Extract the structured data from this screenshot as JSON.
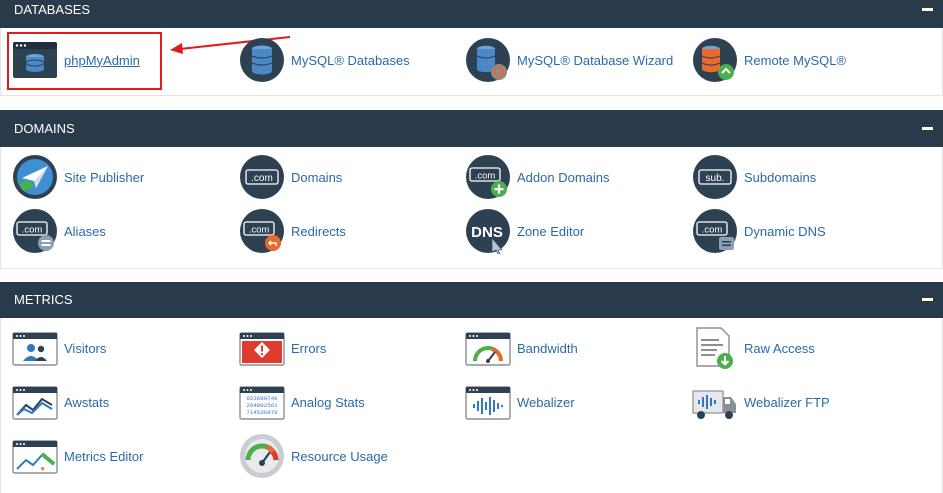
{
  "sections": {
    "databases": {
      "title": "DATABASES",
      "items": [
        {
          "label": "phpMyAdmin",
          "icon": "phpmyadmin-icon"
        },
        {
          "label": "MySQL® Databases",
          "icon": "mysql-databases-icon"
        },
        {
          "label": "MySQL® Database Wizard",
          "icon": "mysql-wizard-icon"
        },
        {
          "label": "Remote MySQL®",
          "icon": "remote-mysql-icon"
        }
      ]
    },
    "domains": {
      "title": "DOMAINS",
      "items": [
        {
          "label": "Site Publisher",
          "icon": "site-publisher-icon"
        },
        {
          "label": "Domains",
          "icon": "domains-icon",
          "glyph": ".com"
        },
        {
          "label": "Addon Domains",
          "icon": "addon-domains-icon",
          "glyph": ".com"
        },
        {
          "label": "Subdomains",
          "icon": "subdomains-icon",
          "glyph": "sub."
        },
        {
          "label": "Aliases",
          "icon": "aliases-icon",
          "glyph": ".com"
        },
        {
          "label": "Redirects",
          "icon": "redirects-icon",
          "glyph": ".com"
        },
        {
          "label": "Zone Editor",
          "icon": "zone-editor-icon",
          "glyph": "DNS"
        },
        {
          "label": "Dynamic DNS",
          "icon": "dynamic-dns-icon",
          "glyph": ".com"
        }
      ]
    },
    "metrics": {
      "title": "METRICS",
      "items": [
        {
          "label": "Visitors",
          "icon": "visitors-icon"
        },
        {
          "label": "Errors",
          "icon": "errors-icon"
        },
        {
          "label": "Bandwidth",
          "icon": "bandwidth-icon"
        },
        {
          "label": "Raw Access",
          "icon": "raw-access-icon"
        },
        {
          "label": "Awstats",
          "icon": "awstats-icon"
        },
        {
          "label": "Analog Stats",
          "icon": "analog-stats-icon",
          "glyph_lines": [
            "023689746",
            "264802561",
            "714536870"
          ]
        },
        {
          "label": "Webalizer",
          "icon": "webalizer-icon"
        },
        {
          "label": "Webalizer FTP",
          "icon": "webalizer-ftp-icon"
        },
        {
          "label": "Metrics Editor",
          "icon": "metrics-editor-icon"
        },
        {
          "label": "Resource Usage",
          "icon": "resource-usage-icon"
        }
      ]
    }
  },
  "colors": {
    "header_bg": "#293a4a",
    "link": "#2a6aa8",
    "highlight": "#e01b1b",
    "icon_dark": "#2e4153",
    "icon_blue": "#2f78c4",
    "orange": "#e8692e",
    "green": "#4cae4c"
  }
}
